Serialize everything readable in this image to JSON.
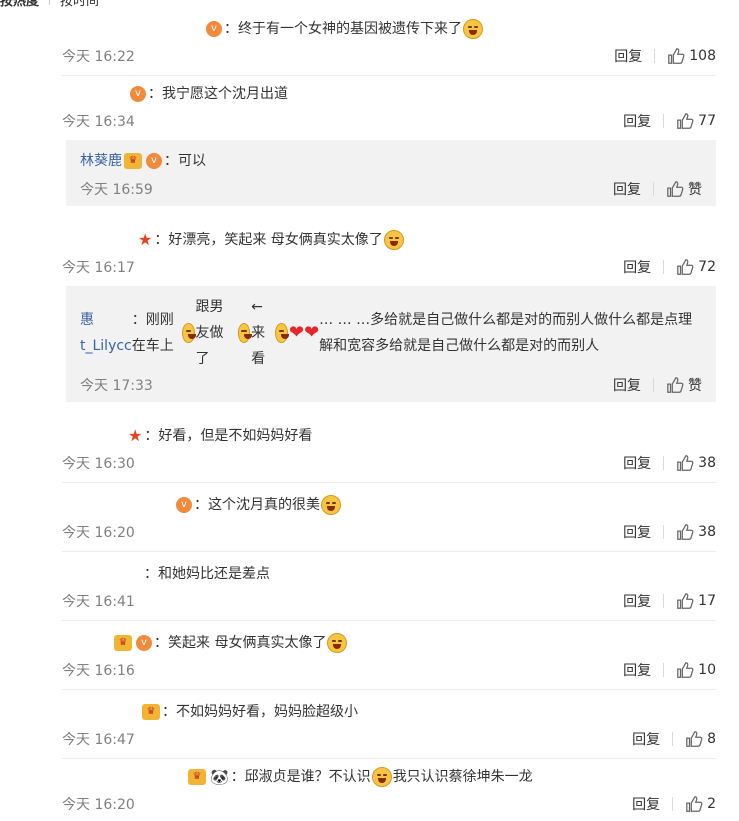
{
  "tabs": {
    "hot": "按热度",
    "time": "按时间"
  },
  "comments": [
    {
      "name_w": 142,
      "badges": [
        "v"
      ],
      "text": "：终于有一个女神的基因被遗传下来了",
      "emoji": "😏",
      "time": "今天 16:22",
      "reply": "回复",
      "likes": "108"
    },
    {
      "name_w": 66,
      "badges": [
        "v"
      ],
      "text": "：我宁愿这个沈月出道",
      "time": "今天 16:34",
      "reply": "回复",
      "likes": "77",
      "sub": {
        "user": "林葵鹿",
        "badges": [
          "crown",
          "v"
        ],
        "text": "：可以",
        "time": "今天 16:59",
        "reply": "回复",
        "likes": "赞"
      }
    },
    {
      "name_w": 74,
      "badges": [
        "star"
      ],
      "text": "：好漂亮，笑起来 母女俩真实太像了",
      "emoji": "😂",
      "time": "今天 16:17",
      "reply": "回复",
      "likes": "72",
      "sub": {
        "user": "惠t_Lilycc",
        "text_a": "：刚刚在车上",
        "text_b": "跟男友做了",
        "text_c": " ←来看",
        "text_d": "… … …多给就是自己做什么都是对的而别人做什么都是点理解和宽容多给就是自己做什么都是对的而别人",
        "time": "今天 17:33",
        "reply": "回复",
        "likes": "赞"
      }
    },
    {
      "name_w": 64,
      "badges": [
        "star"
      ],
      "text": "：好看，但是不如妈妈好看",
      "time": "今天 16:30",
      "reply": "回复",
      "likes": "38"
    },
    {
      "name_w": 112,
      "badges": [
        "v"
      ],
      "text": "：这个沈月真的很美",
      "emoji": "😱",
      "time": "今天 16:20",
      "reply": "回复",
      "likes": "38"
    },
    {
      "name_w": 82,
      "badges": [],
      "text": "：和她妈比还是差点",
      "time": "今天 16:41",
      "reply": "回复",
      "likes": "17"
    },
    {
      "name_w": 50,
      "badges": [
        "crown",
        "v"
      ],
      "text": "：笑起来 母女俩真实太像了",
      "emoji": "😂",
      "time": "今天 16:16",
      "reply": "回复",
      "likes": "10"
    },
    {
      "name_w": 78,
      "badges": [
        "crown"
      ],
      "text": "：不如妈妈好看，妈妈脸超级小",
      "time": "今天 16:47",
      "reply": "回复",
      "likes": "8"
    },
    {
      "name_w": 124,
      "badges": [
        "crown",
        "panda"
      ],
      "text_a": "：邱淑贞是谁？不认识",
      "text_b": "我只认识蔡徐坤朱一龙",
      "time": "今天 16:20",
      "reply": "回复",
      "likes": "2"
    }
  ]
}
